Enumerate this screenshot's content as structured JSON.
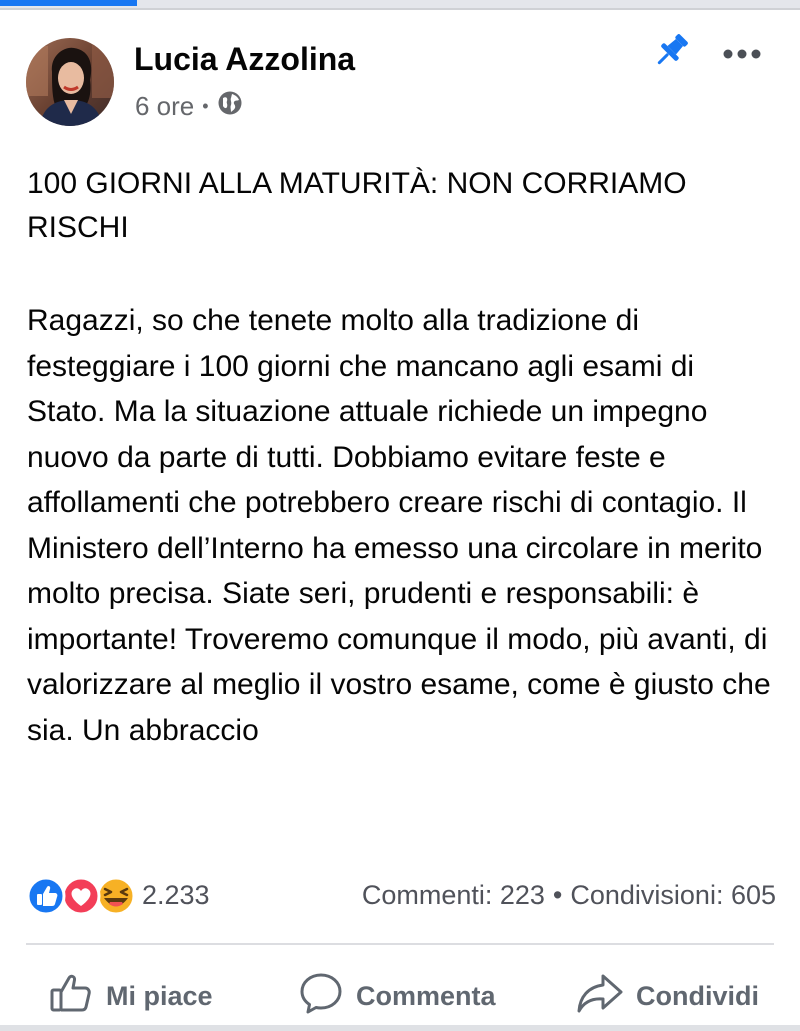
{
  "post": {
    "author": "Lucia Azzolina",
    "time": "6 ore",
    "dot": "•",
    "title": "100 GIORNI ALLA MATURITÀ: NON CORRIAMO RISCHI",
    "body": "Ragazzi, so che tenete molto alla tradizione di festeggiare i 100 giorni che mancano agli esami di Stato. Ma la situazione attuale richiede un impegno nuovo da parte di tutti. Dobbiamo evitare feste e affollamenti che potrebbero creare rischi di contagio. Il Ministero dell’Interno ha emesso una circolare in merito molto precisa. Siate seri, prudenti e responsabili: è importante! Troveremo comunque il modo, più avanti, di valorizzare al meglio il vostro esame, come è giusto che sia. Un abbraccio"
  },
  "reactions": {
    "count": "2.233",
    "icons": [
      "like-icon",
      "love-icon",
      "haha-icon"
    ],
    "comments": "Commenti: 223",
    "separator": "•",
    "shares": "Condivisioni: 605"
  },
  "actions": {
    "like": "Mi piace",
    "comment": "Commenta",
    "share": "Condividi"
  },
  "colors": {
    "accent": "#1877f2",
    "love": "#f33e58",
    "haha": "#f7b125",
    "text": "#050505",
    "muted": "#65676b"
  }
}
